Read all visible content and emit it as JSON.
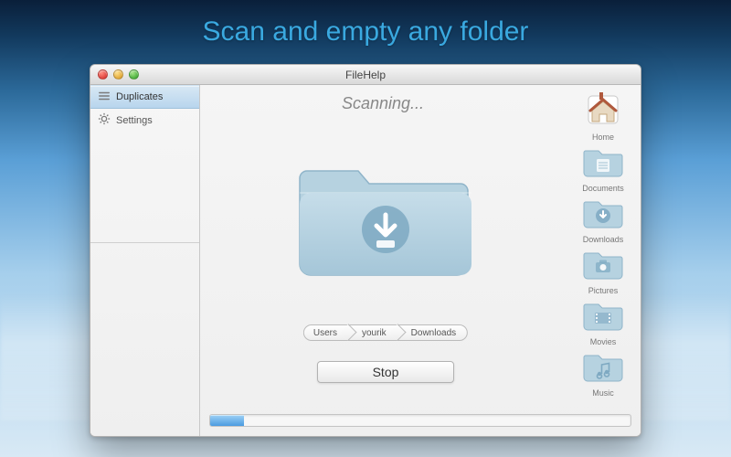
{
  "headline": "Scan and empty any folder",
  "window": {
    "title": "FileHelp"
  },
  "sidebar": {
    "items": [
      {
        "label": "Duplicates",
        "icon": "list-icon",
        "active": true
      },
      {
        "label": "Settings",
        "icon": "gear-icon",
        "active": false
      }
    ]
  },
  "main": {
    "status_text": "Scanning...",
    "breadcrumbs": [
      "Users",
      "yourik",
      "Downloads"
    ],
    "stop_label": "Stop",
    "progress_percent": 8
  },
  "quick_access": [
    {
      "label": "Home",
      "icon": "home-icon"
    },
    {
      "label": "Documents",
      "icon": "documents-folder-icon"
    },
    {
      "label": "Downloads",
      "icon": "downloads-folder-icon"
    },
    {
      "label": "Pictures",
      "icon": "pictures-folder-icon"
    },
    {
      "label": "Movies",
      "icon": "movies-folder-icon"
    },
    {
      "label": "Music",
      "icon": "music-folder-icon"
    }
  ],
  "colors": {
    "folder_fill": "#b6d2e0",
    "folder_stroke": "#8fb4c9",
    "accent": "#4a9be0"
  }
}
